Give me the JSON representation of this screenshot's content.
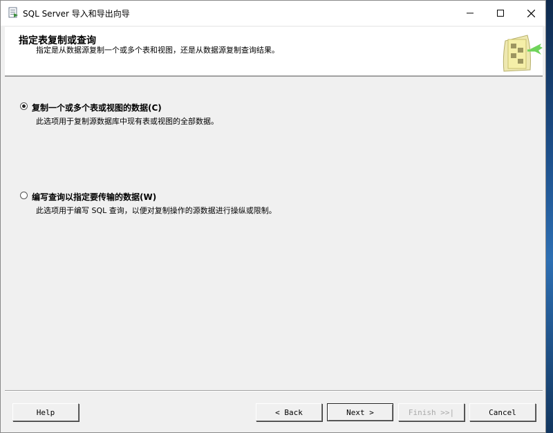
{
  "window": {
    "title": "SQL Server 导入和导出向导",
    "minimize_glyph": "—",
    "maximize_glyph": "☐",
    "close_glyph": "✕"
  },
  "header": {
    "title": "指定表复制或查询",
    "subtitle": "指定是从数据源复制一个或多个表和视图，还是从数据源复制查询结果。"
  },
  "options": [
    {
      "label": "复制一个或多个表或视图的数据(C)",
      "description": "此选项用于复制源数据库中现有表或视图的全部数据。",
      "selected": true
    },
    {
      "label": "编写查询以指定要传输的数据(W)",
      "description": "此选项用于编写 SQL 查询，以便对复制操作的源数据进行操纵或限制。",
      "selected": false
    }
  ],
  "buttons": {
    "help": "Help",
    "back": "< Back",
    "next": "Next >",
    "finish": "Finish >>|",
    "cancel": "Cancel"
  },
  "colors": {
    "window_bg": "#f0f0f0",
    "header_bg": "#ffffff",
    "disabled_text": "#a8a8a8"
  },
  "icons": {
    "app": "sql-server-wizard-icon",
    "header": "database-export-graphic"
  }
}
